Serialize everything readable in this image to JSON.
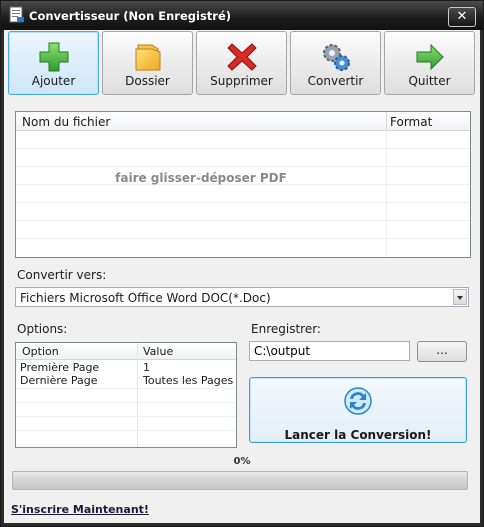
{
  "window": {
    "title": "Convertisseur (Non Enregistré)",
    "close_label": "✕"
  },
  "toolbar": {
    "add_label": "Ajouter",
    "folder_label": "Dossier",
    "delete_label": "Supprimer",
    "convert_label": "Convertir",
    "quit_label": "Quitter"
  },
  "filelist": {
    "col_name": "Nom du fichier",
    "col_format": "Format",
    "drop_hint": "faire glisser-déposer PDF"
  },
  "convert_to": {
    "label": "Convertir vers:",
    "selected": "Fichiers Microsoft Office Word DOC(*.Doc)"
  },
  "options": {
    "label": "Options:",
    "col_option": "Option",
    "col_value": "Value",
    "rows": [
      {
        "option": "Première Page",
        "value": "1"
      },
      {
        "option": "Dernière Page",
        "value": "Toutes les Pages"
      }
    ]
  },
  "output": {
    "label": "Enregistrer:",
    "path": "C:\\output",
    "browse_label": "..."
  },
  "start": {
    "label": "Lancer la Conversion!"
  },
  "progress": {
    "text": "0%",
    "value": 0
  },
  "register_link": "S'inscrire Maintenant!",
  "colors": {
    "accent_blue": "#38a3d9",
    "title_bar": "#1c1c1c",
    "add_green": "#3ea83e",
    "delete_red": "#d62a22"
  }
}
